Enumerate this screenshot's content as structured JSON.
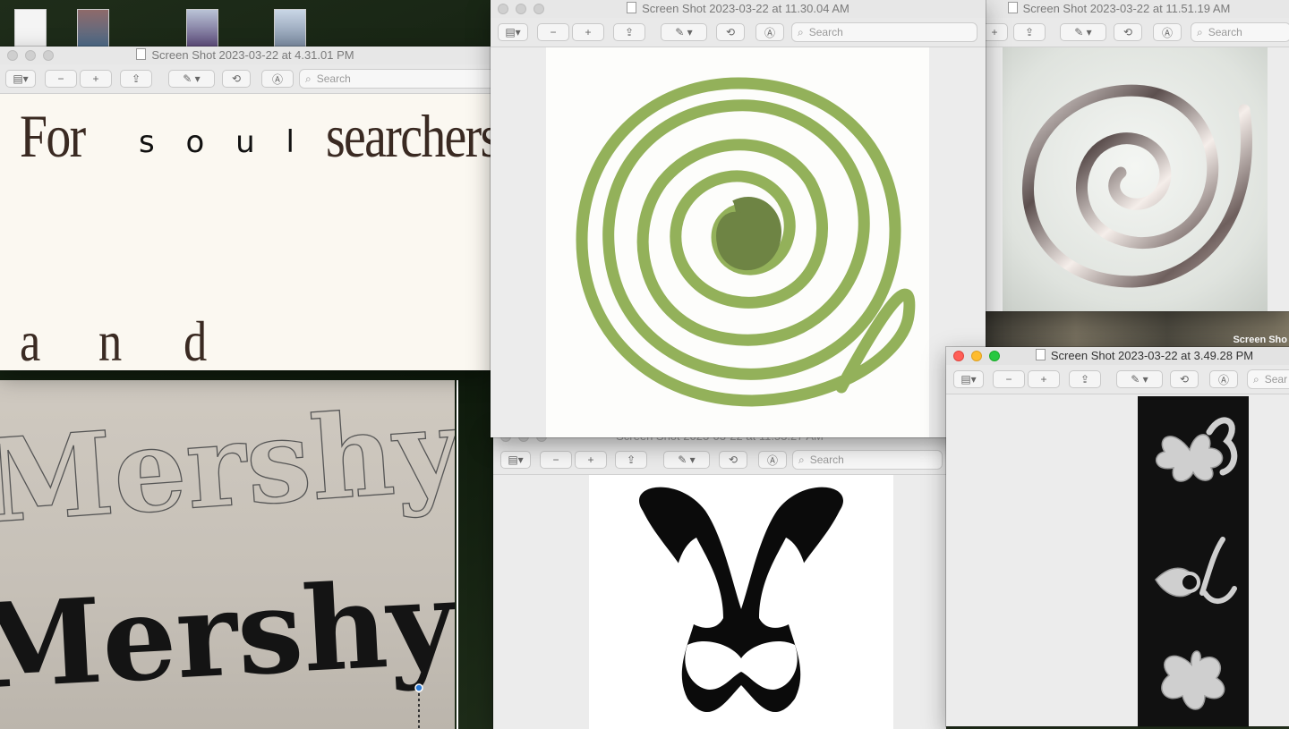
{
  "windows": {
    "w_431": {
      "title": "Screen Shot 2023-03-22 at 4.31.01 PM",
      "search_placeholder": "Search",
      "text": {
        "for": "For",
        "soul": "s o u l",
        "searchers": "searchers",
        "a": "a",
        "n": "n",
        "d": "d"
      }
    },
    "w_1130": {
      "title": "Screen Shot 2023-03-22 at 11.30.04 AM",
      "search_placeholder": "Search"
    },
    "w_1151": {
      "title": "Screen Shot 2023-03-22 at 11.51.19 AM",
      "search_placeholder": "Search"
    },
    "w_349": {
      "title": "Screen Shot 2023-03-22 at 3.49.28 PM",
      "search_placeholder": "Sear"
    },
    "w_hidden": {
      "title": "Screen Shot 2023-03-22 at 11.53.27 AM",
      "search_placeholder": "Search"
    }
  },
  "artwork": {
    "mershy_outline": "Mershy",
    "mershy_solid": "Mershy"
  },
  "desktop_label": "Screen Sho",
  "colors": {
    "spiral_green": "#93b15a",
    "paper": "#fbf8f1",
    "ink": "#3a2a22"
  }
}
